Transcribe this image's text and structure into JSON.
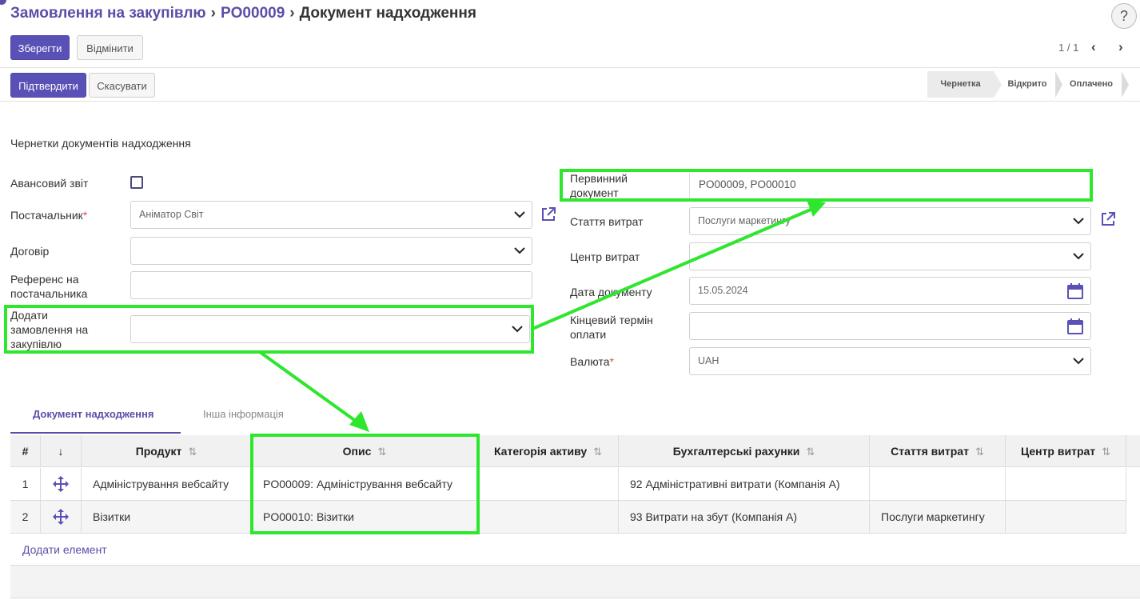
{
  "breadcrumb": {
    "parent": "Замовлення на закупівлю",
    "order": "PO00009",
    "current": "Документ надходження"
  },
  "help": "?",
  "toolbar": {
    "save": "Зберегти",
    "discard": "Відмінити",
    "pager": "1 / 1"
  },
  "actions": {
    "confirm": "Підтвердити",
    "cancel": "Скасувати"
  },
  "statusbar": {
    "stages": [
      "Чернетка",
      "Відкрито",
      "Оплачено"
    ],
    "active": "Чернетка"
  },
  "section_title": "Чернетки документів надходження",
  "form_left": {
    "advance_report": {
      "label": "Авансовий звіт",
      "checked": false
    },
    "supplier": {
      "label": "Постачальник",
      "value": "Аніматор Світ"
    },
    "contract": {
      "label": "Договір",
      "value": ""
    },
    "supplier_ref": {
      "label_line1": "Референс на",
      "label_line2": "постачальника",
      "value": ""
    },
    "add_po": {
      "label_line1": "Додати",
      "label_line2": "замовлення на",
      "label_line3": "закупівлю",
      "value": ""
    }
  },
  "form_right": {
    "primary_doc": {
      "label_line1": "Первинний",
      "label_line2": "документ",
      "value": "PO00009, PO00010"
    },
    "expense_item": {
      "label": "Стаття витрат",
      "value": "Послуги маркетингу"
    },
    "cost_center": {
      "label": "Центр витрат",
      "value": ""
    },
    "doc_date": {
      "label": "Дата документу",
      "value": "15.05.2024"
    },
    "due_date": {
      "label_line1": "Кінцевий термін",
      "label_line2": "оплати",
      "value": ""
    },
    "currency": {
      "label": "Валюта",
      "value": "UAH"
    }
  },
  "tabs": [
    "Документ надходження",
    "Інша інформація"
  ],
  "table": {
    "headers": [
      "#",
      "↓",
      "Продукт",
      "Опис",
      "Категорія активу",
      "Бухгалтерські рахунки",
      "Стаття витрат",
      "Центр витрат"
    ],
    "rows": [
      {
        "num": "1",
        "product": "Адміністрування вебсайту",
        "description": "PO00009: Адміністрування вебсайту",
        "asset_category": "",
        "account": "92 Адміністративні витрати (Компанія А)",
        "expense_item": "",
        "cost_center": ""
      },
      {
        "num": "2",
        "product": "Візитки",
        "description": "PO00010: Візитки",
        "asset_category": "",
        "account": "93 Витрати на збут (Компанія А)",
        "expense_item": "Послуги маркетингу",
        "cost_center": ""
      }
    ],
    "add_line": "Додати елемент"
  },
  "colors": {
    "accent": "#5a4fa7",
    "primary_button": "#5a51b6",
    "annotation": "#2ee62e"
  }
}
